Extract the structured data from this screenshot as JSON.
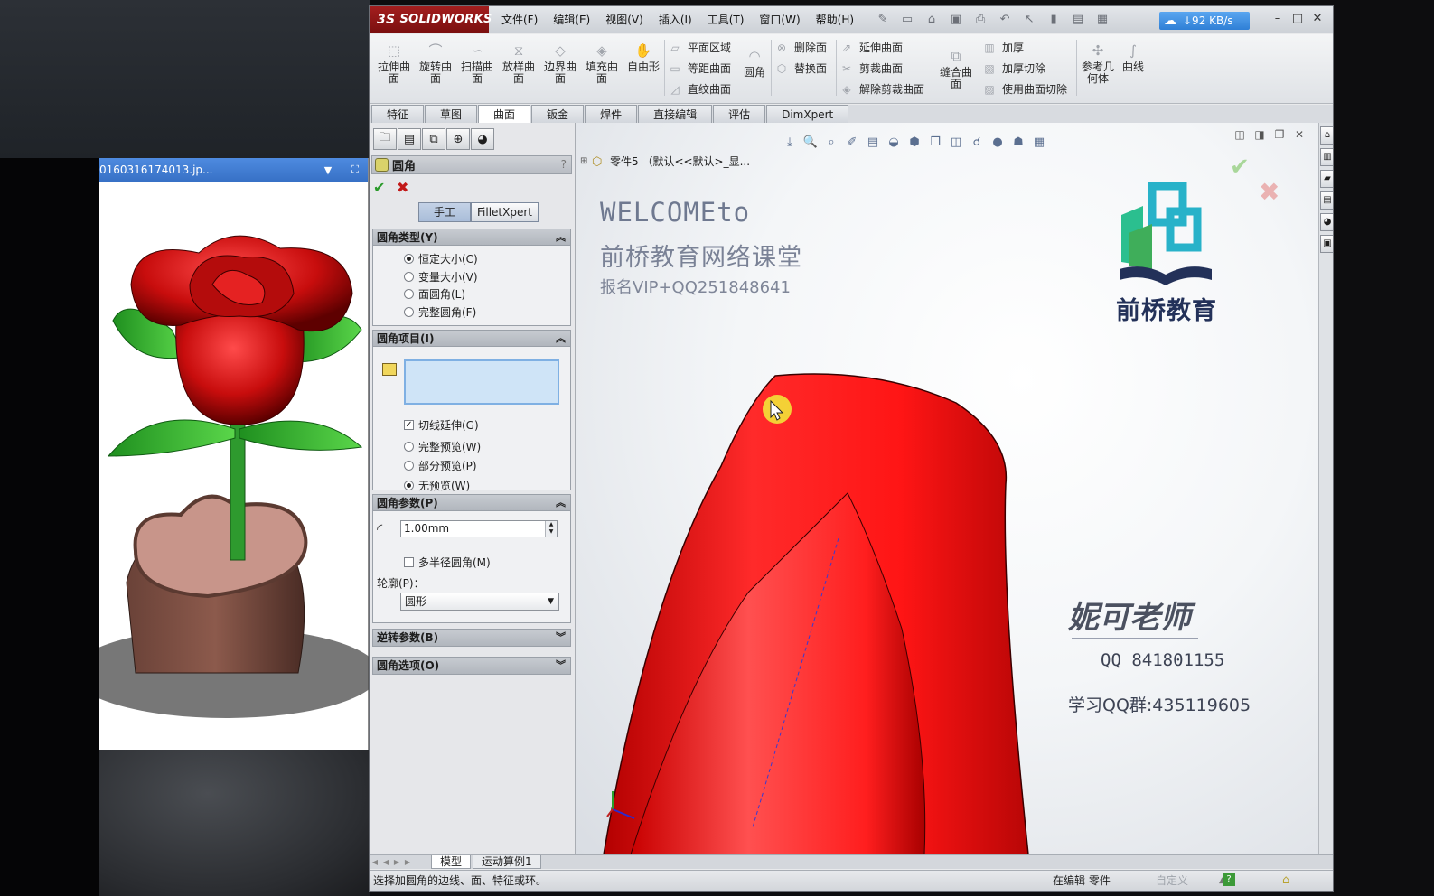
{
  "viewer": {
    "title": "0160316174013.jp...",
    "dropdown_icon": "▼",
    "fullscreen_icon": "⛶"
  },
  "app": {
    "brand": "SOLIDWORKS",
    "brand_prefix": "3S",
    "menu": [
      "文件(F)",
      "编辑(E)",
      "视图(V)",
      "插入(I)",
      "工具(T)",
      "窗口(W)",
      "帮助(H)"
    ],
    "net_speed": "↓92 KB/s",
    "win_min": "–",
    "win_max": "□",
    "win_close": "✕"
  },
  "ribbon": {
    "big_buttons": [
      {
        "line1": "拉伸曲",
        "line2": "面"
      },
      {
        "line1": "旋转曲",
        "line2": "面"
      },
      {
        "line1": "扫描曲",
        "line2": "面"
      },
      {
        "line1": "放样曲",
        "line2": "面"
      },
      {
        "line1": "边界曲",
        "line2": "面"
      },
      {
        "line1": "填充曲",
        "line2": "面"
      },
      {
        "line1": "自由形",
        "line2": ""
      }
    ],
    "group2": [
      "平面区域",
      "等距曲面",
      "直纹曲面"
    ],
    "fillet_button": "圆角",
    "group3": [
      "删除面",
      "替换面"
    ],
    "group4": [
      "延伸曲面",
      "剪裁曲面",
      "解除剪裁曲面"
    ],
    "knit": {
      "line1": "缝合曲",
      "line2": "面"
    },
    "group5": [
      "加厚",
      "加厚切除",
      "使用曲面切除"
    ],
    "ref_geom": {
      "line1": "参考几",
      "line2": "何体"
    },
    "curves": "曲线"
  },
  "command_tabs": [
    "特征",
    "草图",
    "曲面",
    "钣金",
    "焊件",
    "直接编辑",
    "评估",
    "DimXpert"
  ],
  "active_tab": "曲面",
  "property_manager": {
    "title": "圆角",
    "help": "?",
    "ok": "✔",
    "cancel": "✖",
    "mode_manual": "手工",
    "mode_xpert": "FilletXpert",
    "fillet_type": {
      "header": "圆角类型(Y)",
      "options": [
        "恒定大小(C)",
        "变量大小(V)",
        "面圆角(L)",
        "完整圆角(F)"
      ],
      "selected_index": 0
    },
    "fillet_items": {
      "header": "圆角项目(I)",
      "tangent_propagation": "切线延伸(G)",
      "tangent_checked": true,
      "preview_options": [
        "完整预览(W)",
        "部分预览(P)",
        "无预览(W)"
      ],
      "preview_selected": 2
    },
    "fillet_params": {
      "header": "圆角参数(P)",
      "radius": "1.00mm",
      "multi_radius": "多半径圆角(M)",
      "profile_label": "轮廓(P)：",
      "profile_value": "圆形"
    },
    "setback_header": "逆转参数(B)",
    "options_header": "圆角选项(O)"
  },
  "graphics": {
    "tree_label": "零件5 （默认<<默认>_显...",
    "watermark_line1": "WELCOMEto",
    "watermark_line2": "前桥教育网络课堂",
    "watermark_line3": "报名VIP+QQ251848641",
    "brand_name": "前桥教育",
    "teacher_name": "妮可老师",
    "teacher_qq": "QQ 841801155",
    "group_qq": "学习QQ群:435119605",
    "petal_color": "#e8141c"
  },
  "bottom_tabs": [
    "模型",
    "运动算例1"
  ],
  "status": {
    "message": "选择加圆角的边线、面、特征或环。",
    "editing": "在编辑 零件",
    "custom": "自定义",
    "help_icon": "?"
  }
}
